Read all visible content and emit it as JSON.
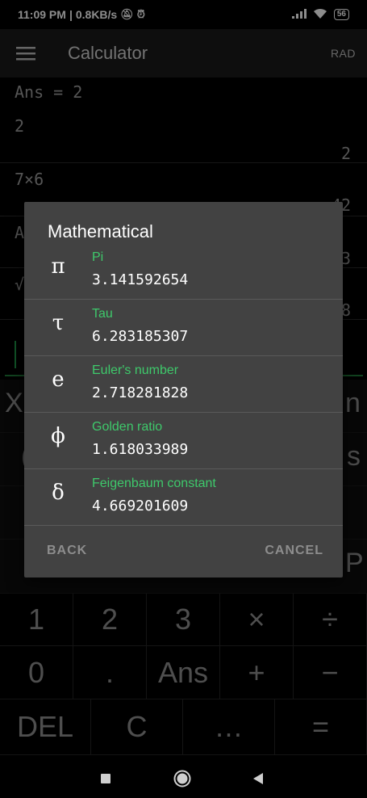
{
  "status": {
    "time": "11:09 PM",
    "speed": "0.8KB/s",
    "battery": "56"
  },
  "app_bar": {
    "title": "Calculator",
    "angle_mode": "RAD"
  },
  "history": [
    {
      "expr": "Ans = 2",
      "value": ""
    },
    {
      "expr": "2",
      "value": "2"
    },
    {
      "expr": "7×6",
      "value": "42"
    },
    {
      "expr": "A",
      "value": "3"
    },
    {
      "expr": "√",
      "value": "8"
    }
  ],
  "function_row_partial": {
    "row1_left": "X",
    "row1_right": "n",
    "row2_left": "(",
    "row2_right": "s",
    "row3_right": "P"
  },
  "keypad": {
    "row1": [
      "1",
      "2",
      "3",
      "×",
      "÷"
    ],
    "row2": [
      "0",
      ".",
      "Ans",
      "+",
      "−"
    ],
    "row3": [
      "DEL",
      "C",
      "…",
      "="
    ]
  },
  "dialog": {
    "title": "Mathematical",
    "constants": [
      {
        "symbol": "π",
        "name": "Pi",
        "value": "3.141592654"
      },
      {
        "symbol": "τ",
        "name": "Tau",
        "value": "6.283185307"
      },
      {
        "symbol": "e",
        "name": "Euler's number",
        "value": "2.718281828"
      },
      {
        "symbol": "ϕ",
        "name": "Golden ratio",
        "value": "1.618033989"
      },
      {
        "symbol": "δ",
        "name": "Feigenbaum constant",
        "value": "4.669201609"
      }
    ],
    "back_label": "BACK",
    "cancel_label": "CANCEL"
  },
  "colors": {
    "accent_green": "#3ec96b",
    "dialog_bg": "#424242"
  }
}
